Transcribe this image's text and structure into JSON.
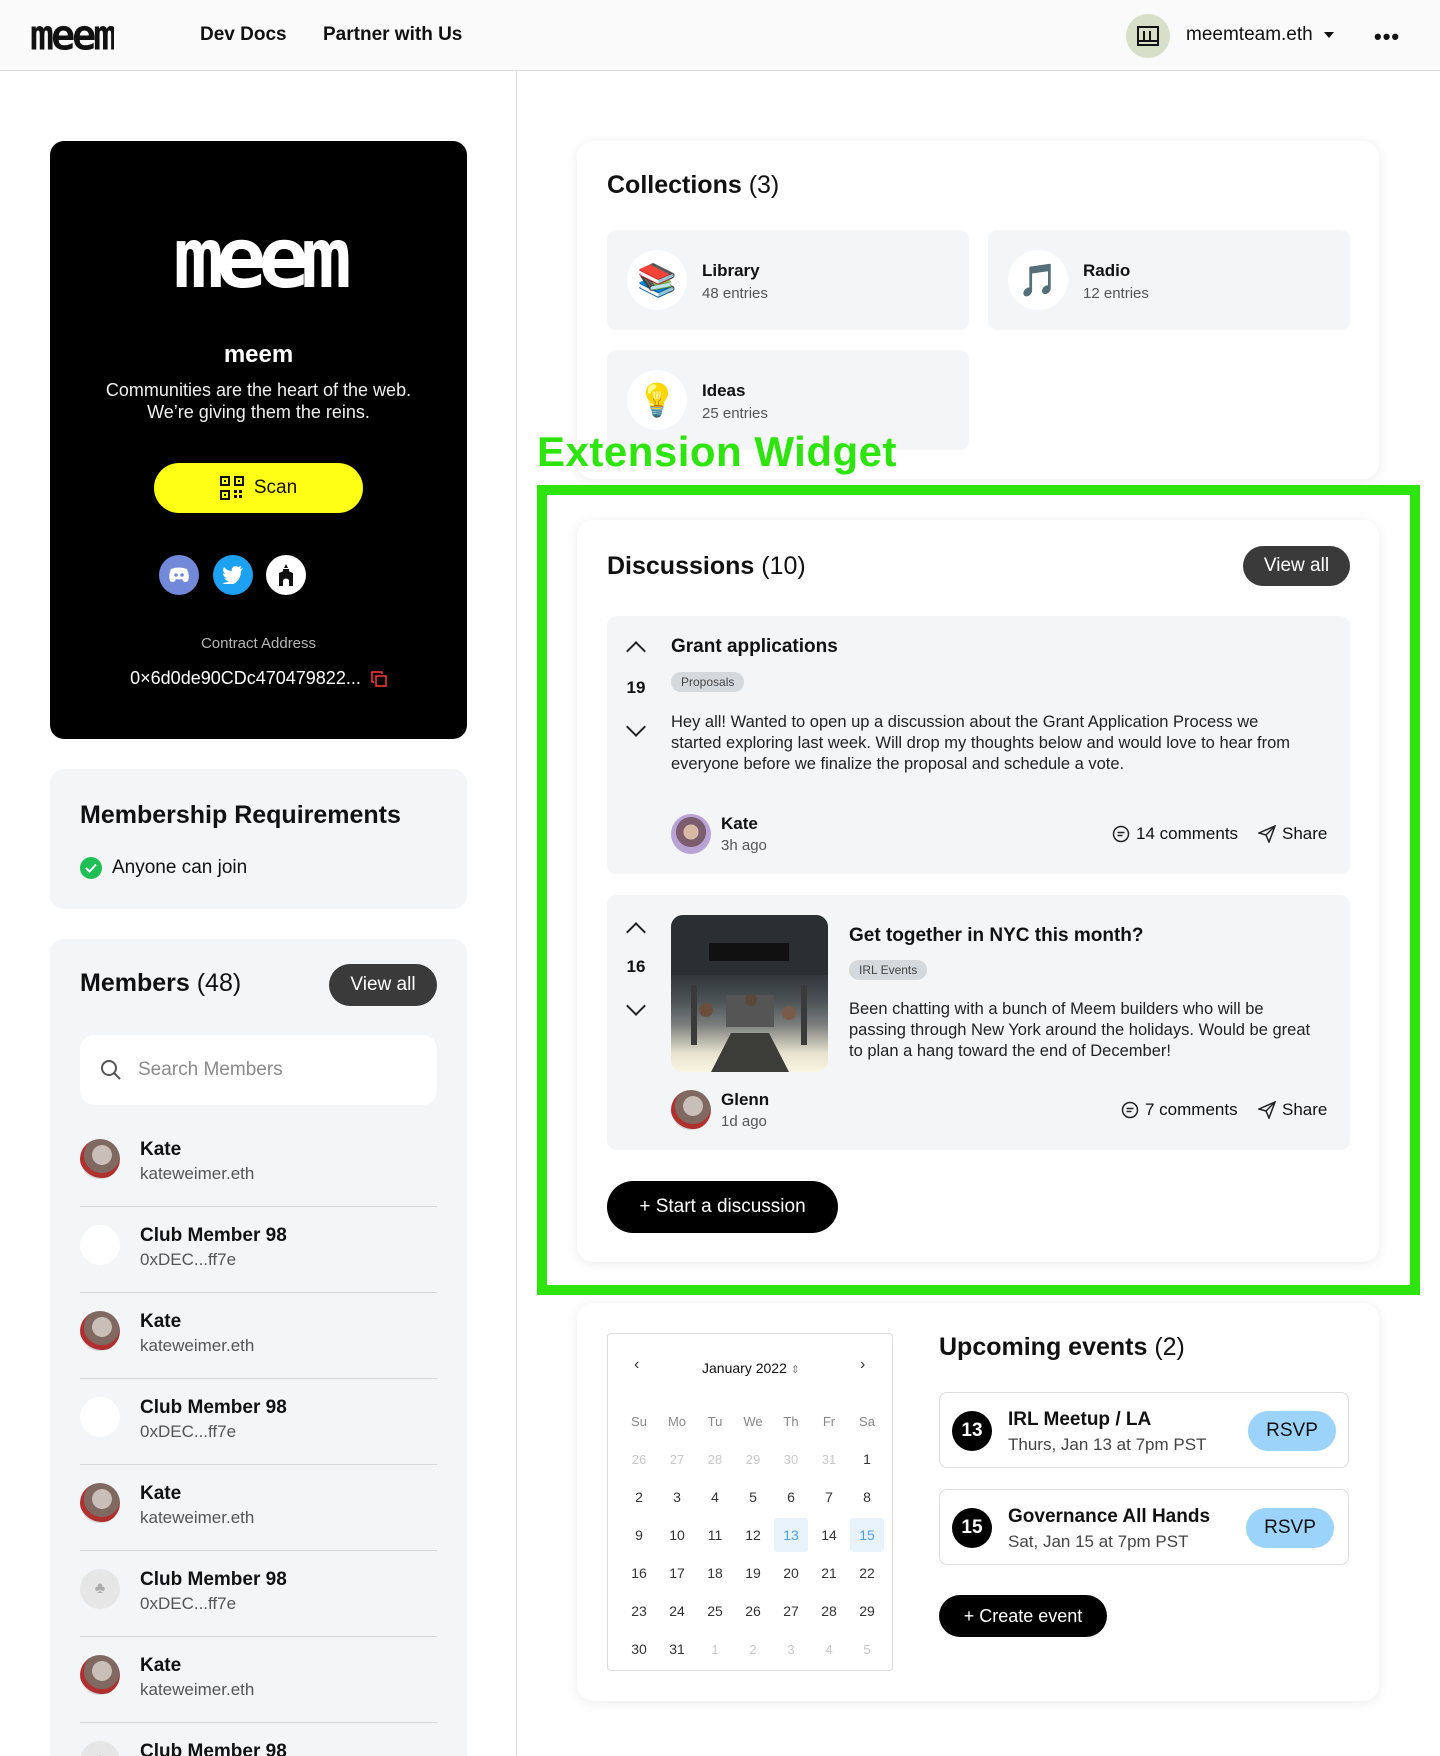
{
  "header": {
    "logo": "meem",
    "nav": [
      "Dev Docs",
      "Partner with Us"
    ],
    "account_name": "meemteam.eth",
    "more_icon": "more-horizontal-icon"
  },
  "profile": {
    "logo": "meem",
    "name": "meem",
    "tagline_1": "Communities are the heart of the web.",
    "tagline_2": "We’re giving them the reins.",
    "scan_label": "Scan",
    "socials": [
      "discord-icon",
      "twitter-icon",
      "castle-icon"
    ],
    "contract_label": "Contract Address",
    "contract_address": "0×6d0de90CDc470479822..."
  },
  "requirements": {
    "title": "Membership Requirements",
    "item": "Anyone can join"
  },
  "members": {
    "title": "Members",
    "count": "(48)",
    "view_all": "View all",
    "search_placeholder": "Search Members",
    "list": [
      {
        "name": "Kate",
        "sub": "kateweimer.eth",
        "avatar": "photo"
      },
      {
        "name": "Club Member 98",
        "sub": "0xDEC...ff7e",
        "avatar": "blank"
      },
      {
        "name": "Kate",
        "sub": "kateweimer.eth",
        "avatar": "photo"
      },
      {
        "name": "Club Member 98",
        "sub": "0xDEC...ff7e",
        "avatar": "blank"
      },
      {
        "name": "Kate",
        "sub": "kateweimer.eth",
        "avatar": "photo"
      },
      {
        "name": "Club Member 98",
        "sub": "0xDEC...ff7e",
        "avatar": "club"
      },
      {
        "name": "Kate",
        "sub": "kateweimer.eth",
        "avatar": "photo"
      },
      {
        "name": "Club Member 98",
        "sub": "",
        "avatar": "club"
      }
    ]
  },
  "collections": {
    "title": "Collections",
    "count": "(3)",
    "items": [
      {
        "name": "Library",
        "count": "48 entries",
        "icon": "books-icon"
      },
      {
        "name": "Radio",
        "count": "12 entries",
        "icon": "music-note-icon"
      },
      {
        "name": "Ideas",
        "count": "25 entries",
        "icon": "lightbulb-icon"
      }
    ]
  },
  "extension_label": "Extension Widget",
  "discussions": {
    "title": "Discussions",
    "count": "(10)",
    "view_all": "View all",
    "items": [
      {
        "votes": "19",
        "title": "Grant applications",
        "tag": "Proposals",
        "body_1": "Hey all! Wanted to open up a discussion about the Grant Application Process we",
        "body_2": "started exploring last week. Will drop my thoughts below and would love to hear from",
        "body_3": "everyone before we finalize the proposal and schedule a vote.",
        "author": "Kate",
        "time": "3h ago",
        "comments": "14 comments",
        "share": "Share"
      },
      {
        "votes": "16",
        "title": "Get together in NYC this month?",
        "tag": "IRL Events",
        "body_1": "Been chatting with a bunch of Meem builders who will be",
        "body_2": "passing through New York around the holidays. Would be great",
        "body_3": "to plan a hang toward the end of December!",
        "author": "Glenn",
        "time": "1d ago",
        "comments": "7 comments",
        "share": "Share"
      }
    ],
    "start_label": "+ Start a discussion"
  },
  "calendar": {
    "month": "January 2022",
    "weekdays": [
      "Su",
      "Mo",
      "Tu",
      "We",
      "Th",
      "Fr",
      "Sa"
    ],
    "days": [
      [
        "26",
        "m"
      ],
      [
        "27",
        "m"
      ],
      [
        "28",
        "m"
      ],
      [
        "29",
        "m"
      ],
      [
        "30",
        "m"
      ],
      [
        "31",
        "m"
      ],
      [
        "1",
        ""
      ],
      [
        "2",
        ""
      ],
      [
        "3",
        ""
      ],
      [
        "4",
        ""
      ],
      [
        "5",
        ""
      ],
      [
        "6",
        ""
      ],
      [
        "7",
        ""
      ],
      [
        "8",
        ""
      ],
      [
        "9",
        ""
      ],
      [
        "10",
        ""
      ],
      [
        "11",
        ""
      ],
      [
        "12",
        ""
      ],
      [
        "13",
        "h"
      ],
      [
        "14",
        ""
      ],
      [
        "15",
        "h"
      ],
      [
        "16",
        ""
      ],
      [
        "17",
        ""
      ],
      [
        "18",
        ""
      ],
      [
        "19",
        ""
      ],
      [
        "20",
        ""
      ],
      [
        "21",
        ""
      ],
      [
        "22",
        ""
      ],
      [
        "23",
        ""
      ],
      [
        "24",
        ""
      ],
      [
        "25",
        ""
      ],
      [
        "26",
        ""
      ],
      [
        "27",
        ""
      ],
      [
        "28",
        ""
      ],
      [
        "29",
        ""
      ],
      [
        "30",
        ""
      ],
      [
        "31",
        ""
      ],
      [
        "1",
        "m"
      ],
      [
        "2",
        "m"
      ],
      [
        "3",
        "m"
      ],
      [
        "4",
        "m"
      ],
      [
        "5",
        "m"
      ]
    ]
  },
  "events": {
    "title": "Upcoming events",
    "count": "(2)",
    "items": [
      {
        "day": "13",
        "name": "IRL Meetup / LA",
        "when": "Thurs, Jan 13 at 7pm PST",
        "rsvp": "RSVP"
      },
      {
        "day": "15",
        "name": "Governance All Hands",
        "when": "Sat, Jan 15 at 7pm PST",
        "rsvp": "RSVP"
      }
    ],
    "create_label": "+ Create event"
  },
  "colors": {
    "accent_green": "#2de40d",
    "scan_yellow": "#ffff16",
    "rsvp_blue": "#9cd3fb"
  }
}
